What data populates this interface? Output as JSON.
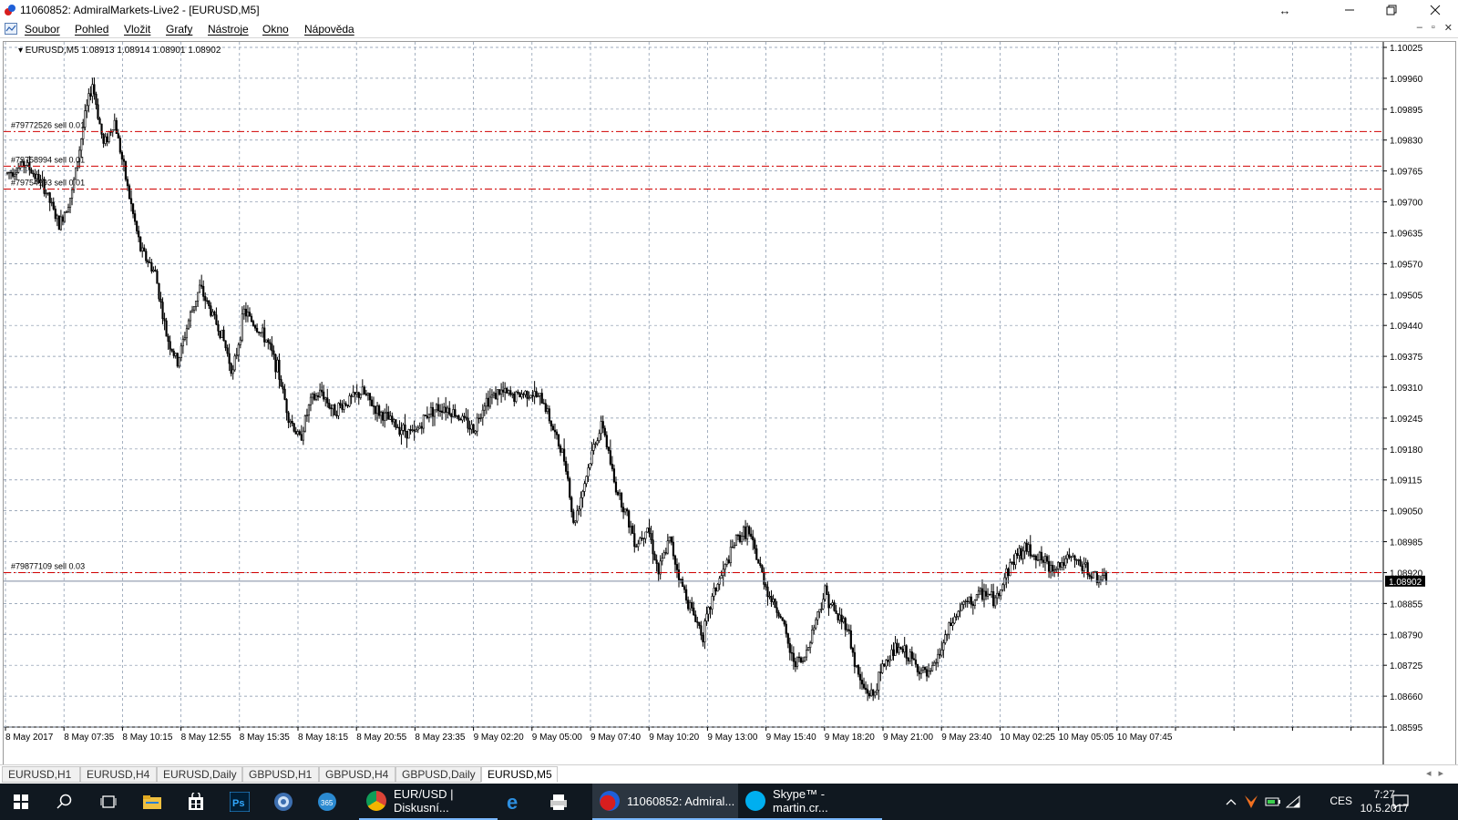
{
  "window": {
    "title": "11060852: AdmiralMarkets-Live2 - [EURUSD,M5]"
  },
  "menu": {
    "items": [
      "Soubor",
      "Pohled",
      "Vložit",
      "Grafy",
      "Nástroje",
      "Okno",
      "Nápověda"
    ]
  },
  "chart_data": {
    "type": "candlestick",
    "symbol_label": "EURUSD,M5",
    "ohlc_label": "1.08913 1.08914 1.08901 1.08902",
    "current_price": "1.08902",
    "price_axis": {
      "ylim": [
        1.08595,
        1.10025
      ],
      "ticks": [
        "1.10025",
        "1.09960",
        "1.09895",
        "1.09830",
        "1.09765",
        "1.09700",
        "1.09635",
        "1.09570",
        "1.09505",
        "1.09440",
        "1.09375",
        "1.09310",
        "1.09245",
        "1.09180",
        "1.09115",
        "1.09050",
        "1.08985",
        "1.08920",
        "1.08855",
        "1.08790",
        "1.08725",
        "1.08660",
        "1.08595"
      ]
    },
    "time_axis": {
      "ticks": [
        "8 May 2017",
        "8 May 07:35",
        "8 May 10:15",
        "8 May 12:55",
        "8 May 15:35",
        "8 May 18:15",
        "8 May 20:55",
        "8 May 23:35",
        "9 May 02:20",
        "9 May 05:00",
        "9 May 07:40",
        "9 May 10:20",
        "9 May 13:00",
        "9 May 15:40",
        "9 May 18:20",
        "9 May 21:00",
        "9 May 23:40",
        "10 May 02:25",
        "10 May 05:05",
        "10 May 07:45"
      ]
    },
    "orders": [
      {
        "label": "#79772526 sell 0.01",
        "price": 1.09848
      },
      {
        "label": "#79758994 sell 0.01",
        "price": 1.09775
      },
      {
        "label": "#79754193 sell 0.01",
        "price": 1.09727
      },
      {
        "label": "#79877109 sell 0.03",
        "price": 1.0892
      }
    ],
    "path_points": [
      [
        0,
        1.0976
      ],
      [
        10,
        1.0978
      ],
      [
        20,
        1.0973
      ],
      [
        28,
        1.0965
      ],
      [
        35,
        1.0972
      ],
      [
        42,
        1.0988
      ],
      [
        46,
        1.0995
      ],
      [
        52,
        1.0982
      ],
      [
        58,
        1.0987
      ],
      [
        66,
        1.0971
      ],
      [
        72,
        1.096
      ],
      [
        80,
        1.0955
      ],
      [
        86,
        1.0942
      ],
      [
        92,
        1.0936
      ],
      [
        98,
        1.0945
      ],
      [
        104,
        1.0952
      ],
      [
        110,
        1.0947
      ],
      [
        116,
        1.0942
      ],
      [
        122,
        1.0934
      ],
      [
        128,
        1.0947
      ],
      [
        134,
        1.0944
      ],
      [
        140,
        1.0941
      ],
      [
        146,
        1.0935
      ],
      [
        152,
        1.0925
      ],
      [
        158,
        1.092
      ],
      [
        164,
        1.0928
      ],
      [
        170,
        1.093
      ],
      [
        176,
        1.0926
      ],
      [
        184,
        1.0928
      ],
      [
        192,
        1.093
      ],
      [
        200,
        1.0926
      ],
      [
        210,
        1.0923
      ],
      [
        220,
        1.0921
      ],
      [
        228,
        1.0926
      ],
      [
        236,
        1.0927
      ],
      [
        244,
        1.0925
      ],
      [
        252,
        1.0922
      ],
      [
        258,
        1.0928
      ],
      [
        266,
        1.093
      ],
      [
        274,
        1.0929
      ],
      [
        282,
        1.093
      ],
      [
        290,
        1.0928
      ],
      [
        296,
        1.0921
      ],
      [
        302,
        1.0915
      ],
      [
        306,
        1.0902
      ],
      [
        312,
        1.0911
      ],
      [
        318,
        1.092
      ],
      [
        322,
        1.0923
      ],
      [
        328,
        1.0911
      ],
      [
        334,
        1.0905
      ],
      [
        340,
        1.0898
      ],
      [
        346,
        1.0902
      ],
      [
        352,
        1.0892
      ],
      [
        358,
        1.0899
      ],
      [
        364,
        1.089
      ],
      [
        370,
        1.0884
      ],
      [
        376,
        1.0879
      ],
      [
        382,
        1.0888
      ],
      [
        388,
        1.0893
      ],
      [
        394,
        1.0899
      ],
      [
        400,
        1.0901
      ],
      [
        406,
        1.0894
      ],
      [
        412,
        1.0887
      ],
      [
        418,
        1.0883
      ],
      [
        424,
        1.0874
      ],
      [
        430,
        1.0873
      ],
      [
        436,
        1.0881
      ],
      [
        442,
        1.0888
      ],
      [
        448,
        1.0883
      ],
      [
        454,
        1.0881
      ],
      [
        458,
        1.0873
      ],
      [
        462,
        1.0868
      ],
      [
        468,
        1.0866
      ],
      [
        474,
        1.0873
      ],
      [
        480,
        1.0876
      ],
      [
        486,
        1.0875
      ],
      [
        492,
        1.0872
      ],
      [
        498,
        1.087
      ],
      [
        504,
        1.0875
      ],
      [
        510,
        1.0881
      ],
      [
        516,
        1.0885
      ],
      [
        522,
        1.0886
      ],
      [
        528,
        1.0888
      ],
      [
        534,
        1.0886
      ],
      [
        540,
        1.0892
      ],
      [
        546,
        1.0896
      ],
      [
        552,
        1.0897
      ],
      [
        558,
        1.0895
      ],
      [
        564,
        1.0893
      ],
      [
        570,
        1.0894
      ],
      [
        576,
        1.0895
      ],
      [
        582,
        1.0893
      ],
      [
        588,
        1.0891
      ],
      [
        594,
        1.08902
      ]
    ]
  },
  "tabs": [
    "EURUSD,H1",
    "EURUSD,H4",
    "EURUSD,Daily",
    "GBPUSD,H1",
    "GBPUSD,H4",
    "GBPUSD,Daily",
    "EURUSD,M5"
  ],
  "active_tab": "EURUSD,M5",
  "taskbar": {
    "apps": [
      {
        "label": "EUR/USD | Diskusní...",
        "icon": "chrome-icon"
      },
      {
        "label": "11060852: Admiral...",
        "icon": "metatrader-icon"
      },
      {
        "label": "Skype™ - martin.cr...",
        "icon": "skype-icon"
      }
    ],
    "language": "CES",
    "time": "7:27",
    "date": "10.5.2017"
  },
  "colors": {
    "order_line": "#d00000",
    "candle": "#000000",
    "grid": "#7f8fa6",
    "price_tag_bg": "#000000",
    "taskbar_bg": "#101820"
  }
}
